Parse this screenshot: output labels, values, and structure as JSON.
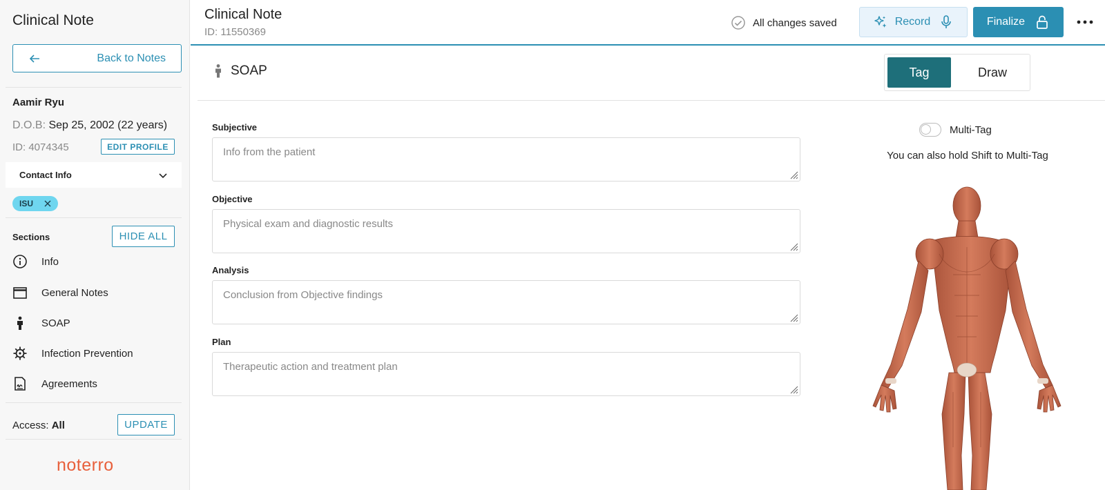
{
  "sidebar": {
    "title": "Clinical Note",
    "back_label": "Back to Notes",
    "patient": {
      "name": "Aamir Ryu",
      "dob_label": "D.O.B:",
      "dob_value": "Sep 25, 2002 (22 years)",
      "id": "ID: 4074345",
      "edit_label": "EDIT PROFILE"
    },
    "contact_label": "Contact Info",
    "chip_label": "ISU",
    "sections_label": "Sections",
    "hide_all_label": "HIDE ALL",
    "sections": [
      {
        "label": "Info",
        "icon": "info-icon"
      },
      {
        "label": "General Notes",
        "icon": "window-icon"
      },
      {
        "label": "SOAP",
        "icon": "person-icon"
      },
      {
        "label": "Infection Prevention",
        "icon": "virus-icon"
      },
      {
        "label": "Agreements",
        "icon": "document-signature-icon"
      }
    ],
    "access_label": "Access:",
    "access_value": "All",
    "update_label": "UPDATE",
    "logo": "noterro"
  },
  "header": {
    "title": "Clinical Note",
    "note_id": "ID: 11550369",
    "saved_status": "All changes saved",
    "record_label": "Record",
    "finalize_label": "Finalize"
  },
  "soap": {
    "title": "SOAP",
    "modes": {
      "tag": "Tag",
      "draw": "Draw"
    },
    "active_mode": "Tag",
    "fields": [
      {
        "label": "Subjective",
        "placeholder": "Info from the patient"
      },
      {
        "label": "Objective",
        "placeholder": "Physical exam and diagnostic results"
      },
      {
        "label": "Analysis",
        "placeholder": "Conclusion from Objective findings"
      },
      {
        "label": "Plan",
        "placeholder": "Therapeutic action and treatment plan"
      }
    ],
    "multitag_label": "Multi-Tag",
    "multitag_on": false,
    "shift_hint": "You can also hold Shift to Multi-Tag"
  },
  "colors": {
    "accent": "#2b8fb3",
    "tag_active": "#1e6f7a",
    "chip": "#6fd6ef",
    "logo": "#e8603c",
    "muscle": "#c8684a"
  }
}
